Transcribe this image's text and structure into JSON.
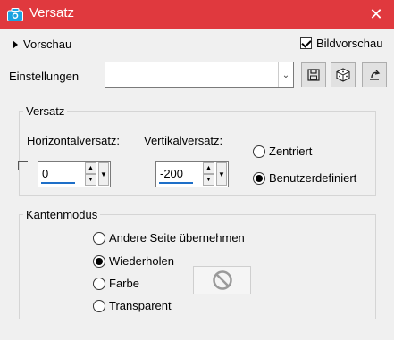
{
  "window": {
    "title": "Versatz",
    "close_label": "✕"
  },
  "preview": {
    "toggle_label": "Vorschau",
    "bild_label": "Bildvorschau",
    "bild_checked": true
  },
  "presets": {
    "label": "Einstellungen",
    "value": ""
  },
  "offset": {
    "group_title": "Versatz",
    "horizontal_label": "Horizontalversatz:",
    "horizontal_value": "0",
    "vertical_label": "Vertikalversatz:",
    "vertical_value": "-200",
    "options": [
      {
        "label": "Zentriert",
        "selected": false
      },
      {
        "label": "Benutzerdefiniert",
        "selected": true
      }
    ]
  },
  "edge": {
    "group_title": "Kantenmodus",
    "options": [
      {
        "label": "Andere Seite übernehmen",
        "selected": false
      },
      {
        "label": "Wiederholen",
        "selected": true
      },
      {
        "label": "Farbe",
        "selected": false
      },
      {
        "label": "Transparent",
        "selected": false
      }
    ]
  }
}
